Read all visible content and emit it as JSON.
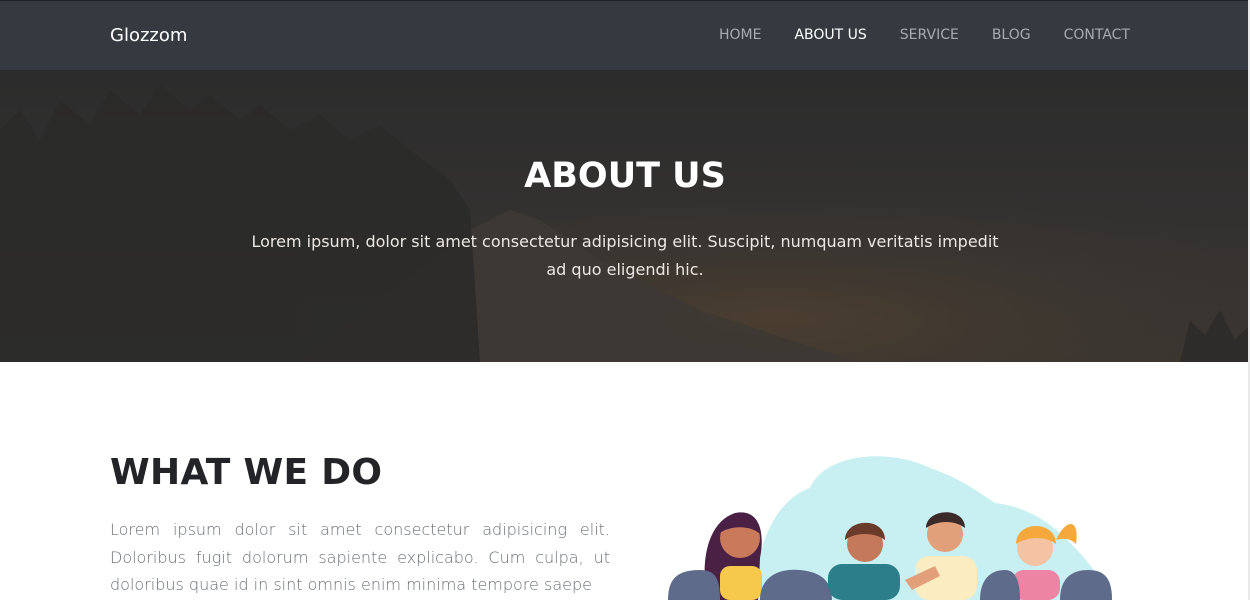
{
  "navbar": {
    "brand": "Glozzom",
    "links": [
      {
        "label": "HOME",
        "active": false
      },
      {
        "label": "ABOUT US",
        "active": true
      },
      {
        "label": "SERVICE",
        "active": false
      },
      {
        "label": "BLOG",
        "active": false
      },
      {
        "label": "CONTACT",
        "active": false
      }
    ]
  },
  "hero": {
    "title": "ABOUT US",
    "text": "Lorem ipsum, dolor sit amet consectetur adipisicing elit. Suscipit, numquam veritatis impedit ad quo eligendi hic."
  },
  "what_we_do": {
    "title": "WHAT WE DO",
    "text": "Lorem ipsum dolor sit amet consectetur adipisicing elit. Doloribus fugit dolorum sapiente explicabo. Cum culpa, ut doloribus quae id in sint omnis enim minima tempore saepe"
  },
  "colors": {
    "navbar_bg": "#343a40",
    "hero_overlay": "#2e2e2e",
    "illustration_blob": "#c8f0f3"
  }
}
